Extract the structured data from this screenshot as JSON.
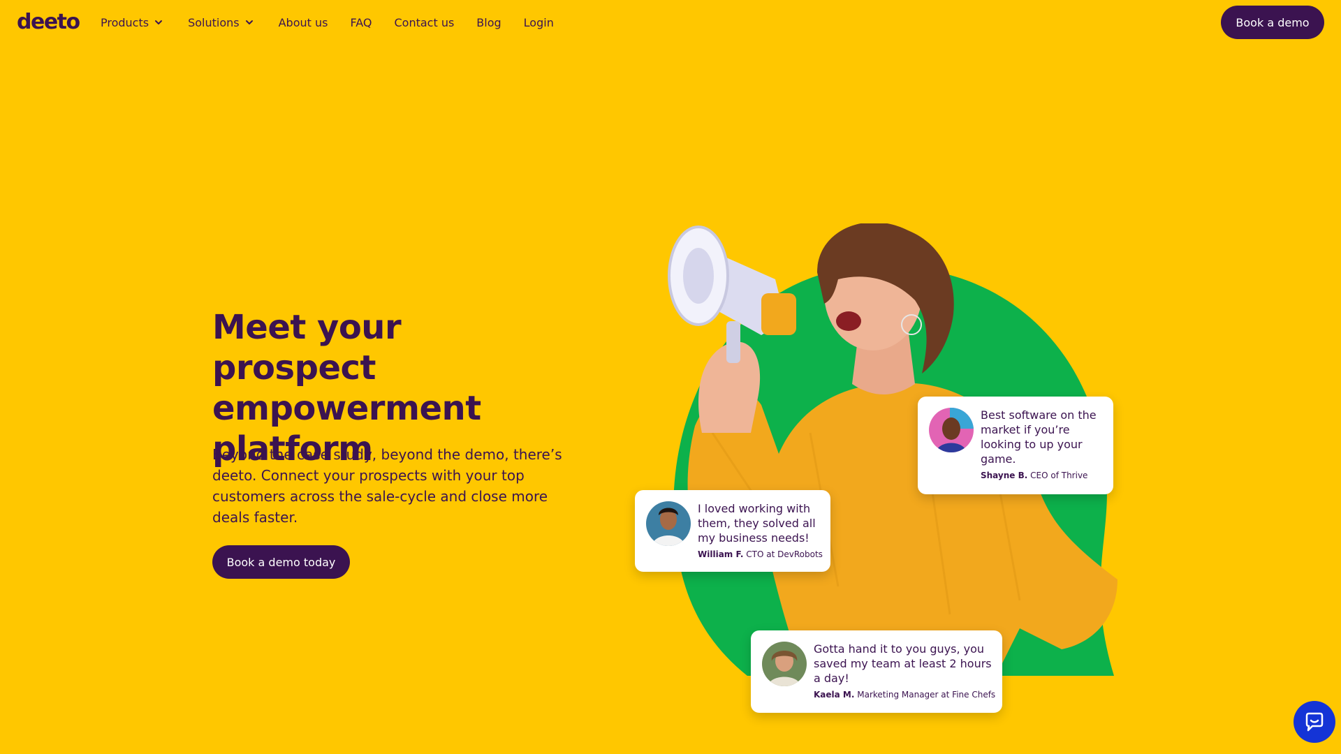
{
  "brand": {
    "logo_text": "deeto"
  },
  "nav": {
    "items": [
      {
        "label": "Products",
        "has_dropdown": true
      },
      {
        "label": "Solutions",
        "has_dropdown": true
      },
      {
        "label": "About us",
        "has_dropdown": false
      },
      {
        "label": "FAQ",
        "has_dropdown": false
      },
      {
        "label": "Contact us",
        "has_dropdown": false
      },
      {
        "label": "Blog",
        "has_dropdown": false
      },
      {
        "label": "Login",
        "has_dropdown": false
      }
    ],
    "cta_label": "Book a demo"
  },
  "hero": {
    "title_line1": "Meet your prospect",
    "title_line2": "empowerment",
    "title_line3": "platform",
    "subtitle": "Beyond the case study, beyond the demo, there’s deeto. Connect your prospects with your top customers across the sale-cycle and close more deals faster.",
    "cta_label": "Book a demo today"
  },
  "testimonials": [
    {
      "quote": "Best software on the market if you’re looking to up your game.",
      "name": "Shayne B.",
      "role": "CEO of Thrive"
    },
    {
      "quote": "I loved working with them, they solved all my business needs!",
      "name": "William F.",
      "role": "CTO at DevRobots"
    },
    {
      "quote": "Gotta hand it to you guys, you saved my team at least 2 hours a day!",
      "name": "Kaela M.",
      "role": "Marketing Manager at Fine Chefs"
    }
  ],
  "colors": {
    "background": "#FFC700",
    "brand_purple": "#3B1350",
    "accent_green": "#0DB14B",
    "sweater": "#F2A81D",
    "chat_blue": "#1434D6"
  },
  "icons": {
    "dropdown": "chevron-down-icon",
    "chat": "chat-bubble-icon",
    "megaphone": "megaphone-icon"
  }
}
